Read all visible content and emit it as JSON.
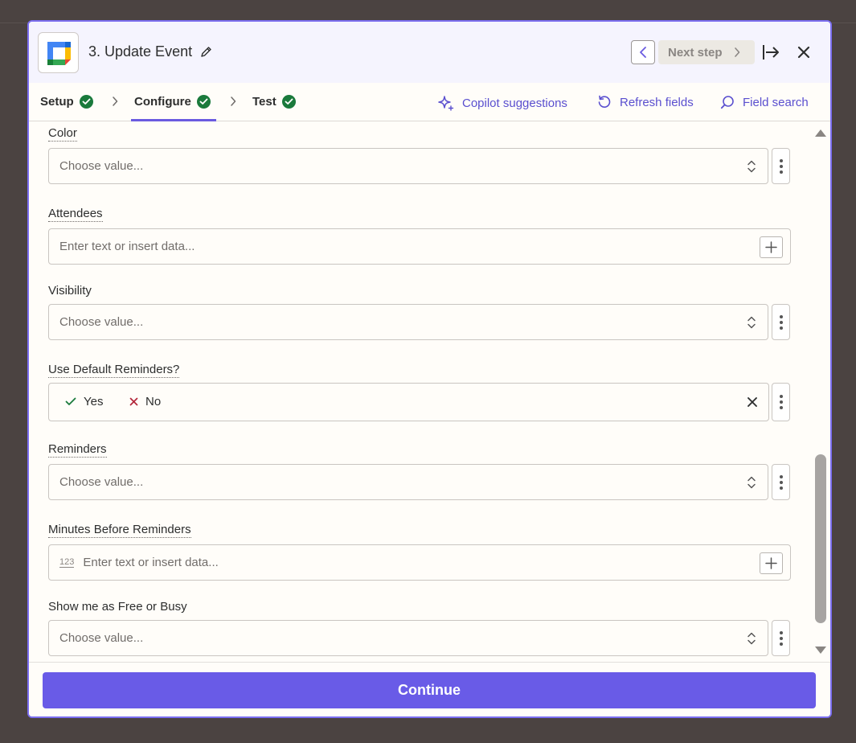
{
  "header": {
    "title": "3. Update Event",
    "next_label": "Next step"
  },
  "tabs": [
    {
      "label": "Setup"
    },
    {
      "label": "Configure"
    },
    {
      "label": "Test"
    }
  ],
  "tools": {
    "copilot": "Copilot suggestions",
    "refresh": "Refresh fields",
    "search": "Field search"
  },
  "fields": {
    "color": {
      "label": "Color",
      "placeholder": "Choose value..."
    },
    "attendees": {
      "label": "Attendees",
      "placeholder": "Enter text or insert data..."
    },
    "visibility": {
      "label": "Visibility",
      "placeholder": "Choose value..."
    },
    "default_reminders": {
      "label": "Use Default Reminders?",
      "yes": "Yes",
      "no": "No"
    },
    "reminders": {
      "label": "Reminders",
      "placeholder": "Choose value..."
    },
    "minutes": {
      "label": "Minutes Before Reminders",
      "badge": "123",
      "placeholder": "Enter text or insert data..."
    },
    "free_busy": {
      "label": "Show me as Free or Busy",
      "placeholder": "Choose value..."
    }
  },
  "footer": {
    "continue_label": "Continue"
  },
  "colors": {
    "accent": "#695be7",
    "success": "#1a7a3c",
    "backdrop": "#4b4341"
  },
  "icons": [
    "google-calendar-icon",
    "pencil-icon",
    "chevron-left-icon",
    "chevron-right-icon",
    "collapse-icon",
    "close-icon",
    "check-circle-icon",
    "sparkle-icon",
    "refresh-icon",
    "search-icon",
    "up-down-icon",
    "plus-icon",
    "kebab-icon",
    "check-icon",
    "x-icon"
  ]
}
